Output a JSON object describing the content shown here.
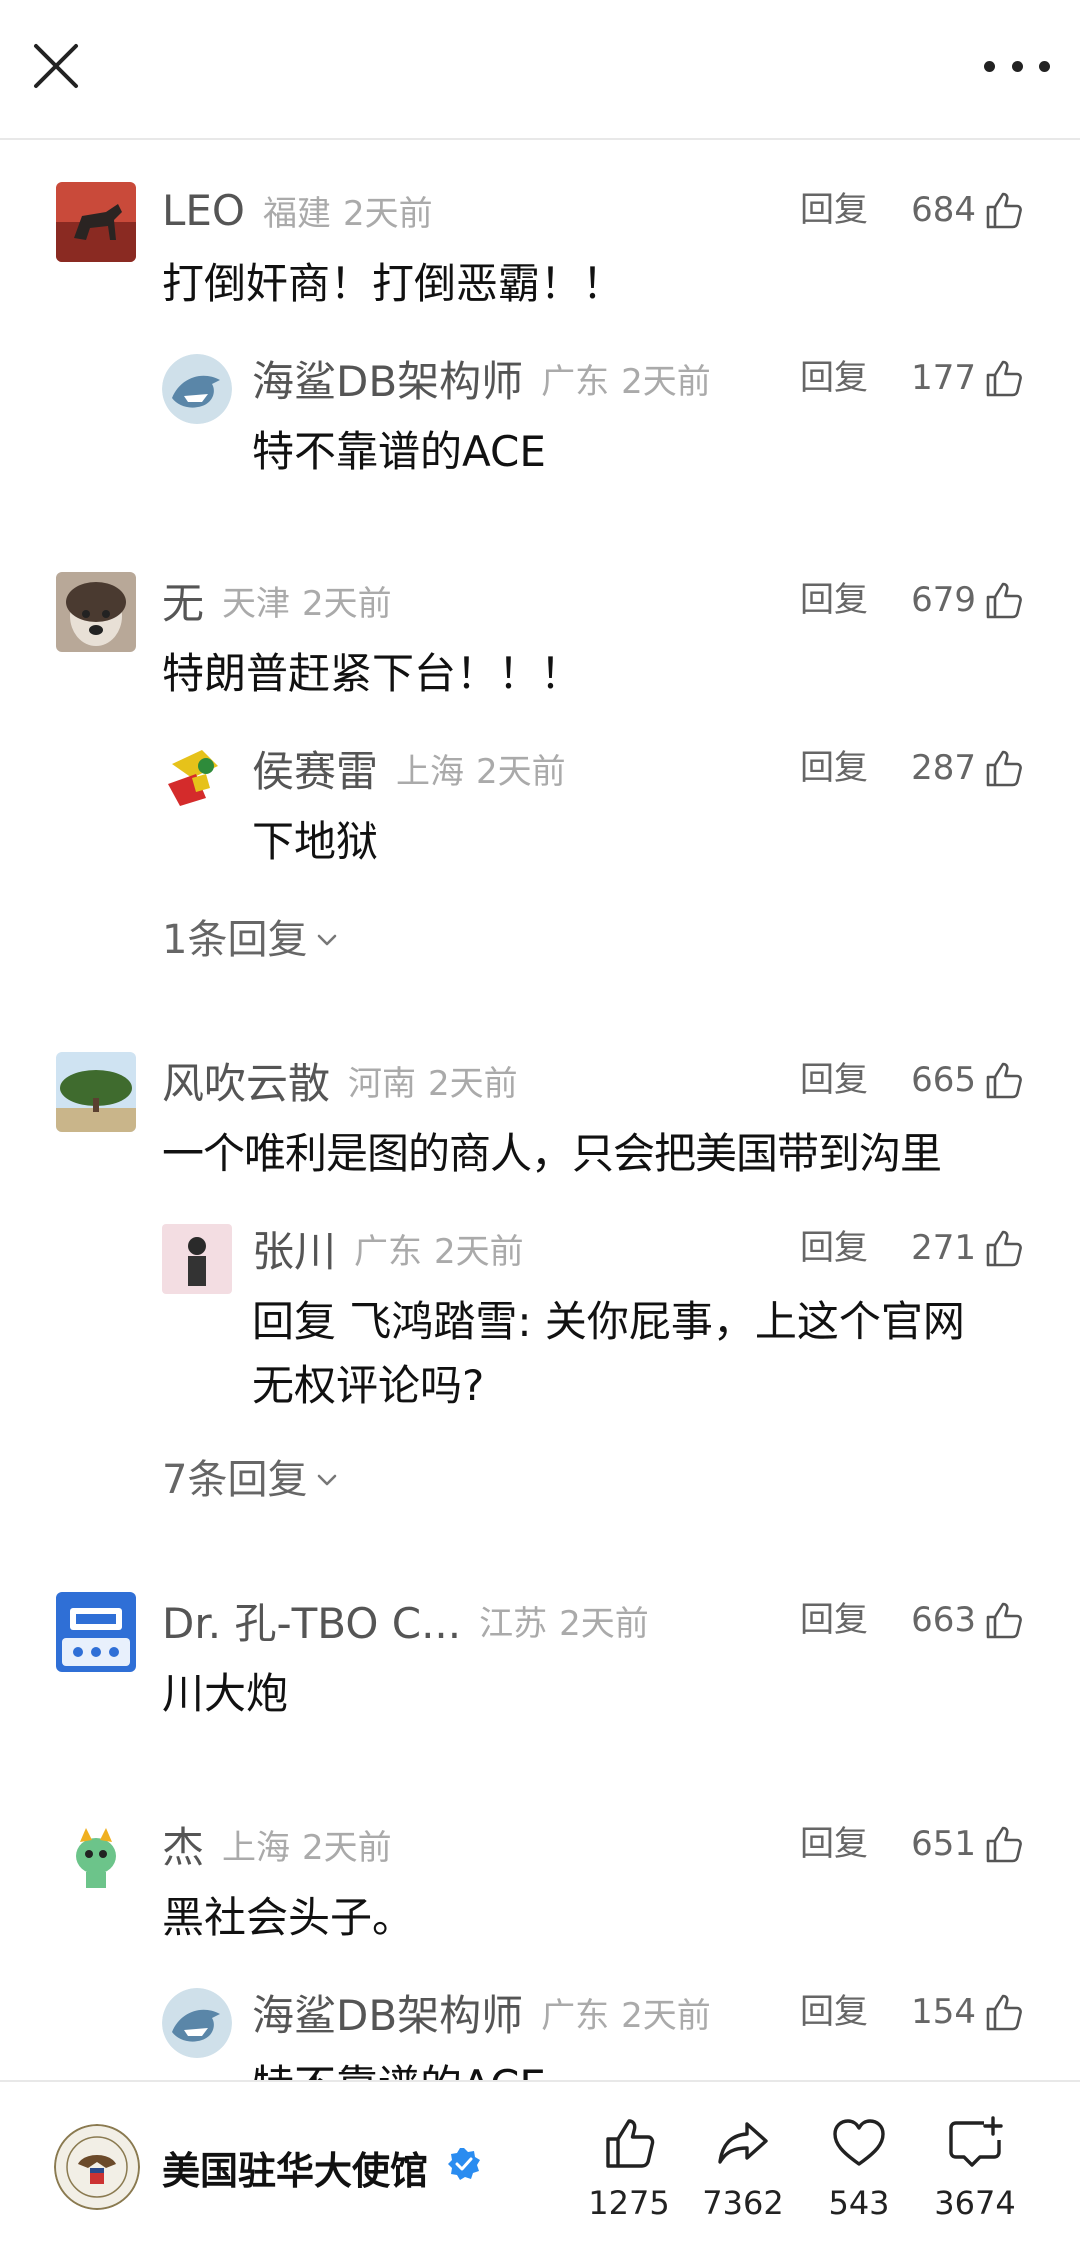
{
  "comments": [
    {
      "name": "LEO",
      "region": "福建",
      "time": "2天前",
      "reply": "回复",
      "likes": "684",
      "text": "打倒奸商！打倒恶霸！！",
      "sub": {
        "name": "海鲨DB架构师",
        "region": "广东",
        "time": "2天前",
        "reply": "回复",
        "likes": "177",
        "text": "特不靠谱的ACE"
      }
    },
    {
      "name": "无",
      "region": "天津",
      "time": "2天前",
      "reply": "回复",
      "likes": "679",
      "text": "特朗普赶紧下台！！！",
      "sub": {
        "name": "侯赛雷",
        "region": "上海",
        "time": "2天前",
        "reply": "回复",
        "likes": "287",
        "text": "下地狱"
      },
      "more": "1条回复"
    },
    {
      "name": "风吹云散",
      "region": "河南",
      "time": "2天前",
      "reply": "回复",
      "likes": "665",
      "text": "一个唯利是图的商人，只会把美国带到沟里",
      "sub": {
        "name": "张川",
        "region": "广东",
        "time": "2天前",
        "reply": "回复",
        "likes": "271",
        "text": "回复 飞鸿踏雪: 关你屁事，上这个官网",
        "text2": "无权评论吗?"
      },
      "more": "7条回复"
    },
    {
      "name": "Dr. 孔-TBO C...",
      "region": "江苏",
      "time": "2天前",
      "reply": "回复",
      "likes": "663",
      "text": "川大炮"
    },
    {
      "name": "杰",
      "region": "上海",
      "time": "2天前",
      "reply": "回复",
      "likes": "651",
      "text": "黑社会头子。",
      "sub": {
        "name": "海鲨DB架构师",
        "region": "广东",
        "time": "2天前",
        "reply": "回复",
        "likes": "154",
        "text": "特不靠谱的ACE"
      }
    }
  ],
  "bottom": {
    "name": "美国驻华大使馆",
    "actions": [
      {
        "icon": "thumbs-up-icon",
        "count": "1275"
      },
      {
        "icon": "share-icon",
        "count": "7362"
      },
      {
        "icon": "heart-icon",
        "count": "543"
      },
      {
        "icon": "comment-add-icon",
        "count": "3674"
      }
    ]
  }
}
